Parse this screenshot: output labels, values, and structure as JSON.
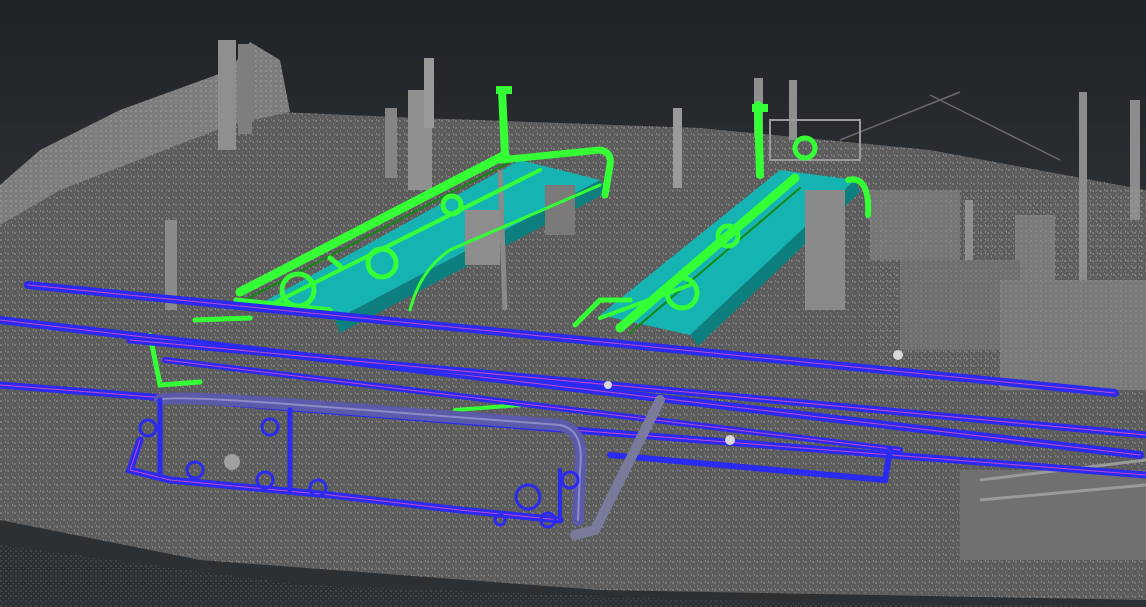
{
  "viewport": {
    "background_color": "#2b2e31",
    "point_cloud_color": "#9a9a9a",
    "ground_color": "#6e6e6e"
  },
  "model_colors": {
    "skid_pad": "#16b3b3",
    "equipment_piping": "#35ff35",
    "process_piping": "#2a2af0",
    "pipe_highlight": "#c447c4",
    "structure": "#8c8c8c"
  },
  "icons": [
    "skid-pad-icon",
    "pump-motor-icon",
    "pipe-rack-icon",
    "valve-handwheel-icon"
  ]
}
